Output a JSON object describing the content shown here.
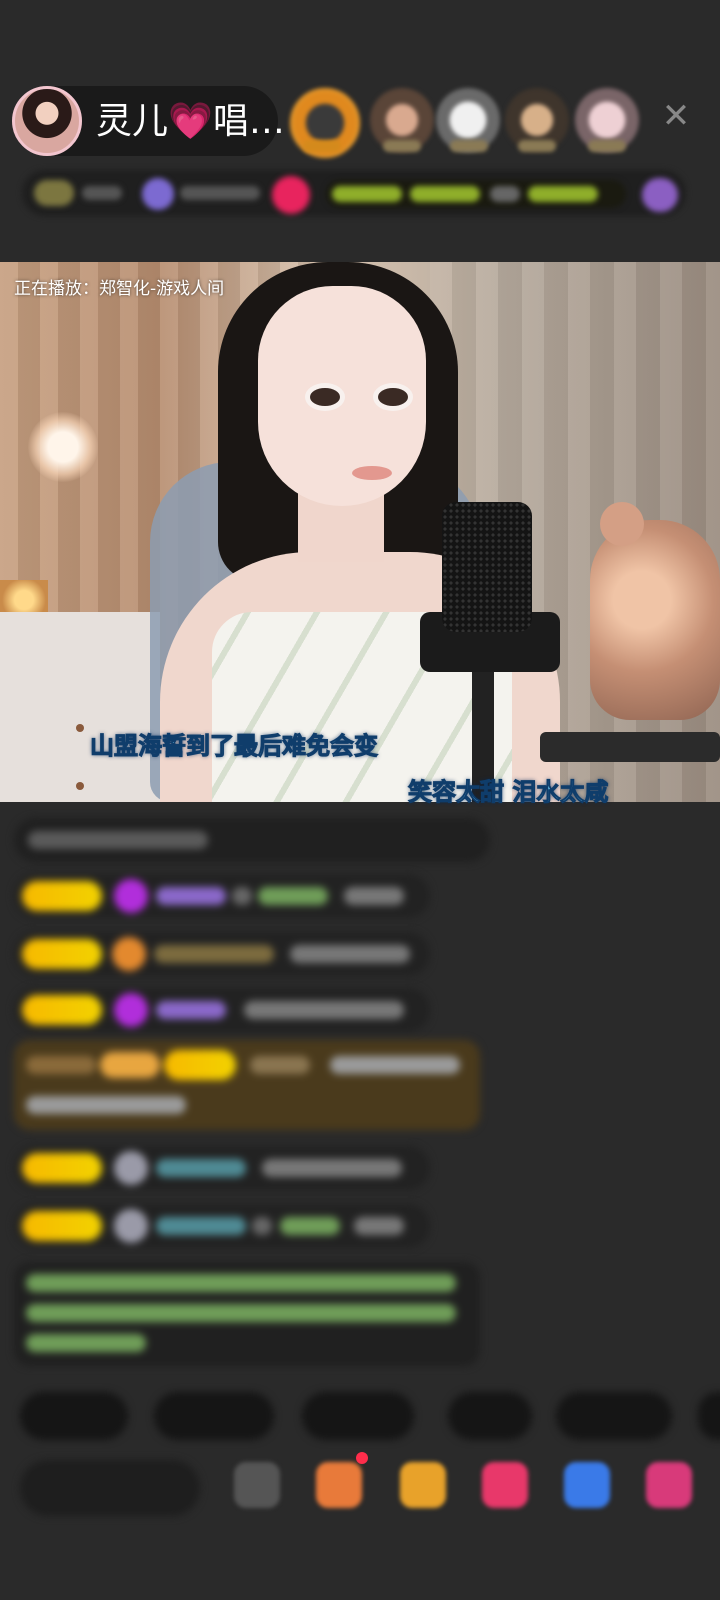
{
  "header": {
    "host_name": "灵儿💗唱…",
    "close_icon": "✕",
    "viewer_avatars": [
      "viewer-1",
      "viewer-2",
      "viewer-3",
      "viewer-4",
      "viewer-5"
    ]
  },
  "video": {
    "now_playing": "正在播放：郑智化-游戏人间",
    "lyric_line_1": "山盟海誓到了最后难免会变",
    "lyric_line_2": "笑容太甜  泪水太咸"
  },
  "chat": {
    "messages_count_visible": 9
  },
  "colors": {
    "background": "#2a2a2a",
    "lyric": "#7ad8ff",
    "badge_gold": "#f7b900",
    "chat_green": "#8bd36b"
  }
}
